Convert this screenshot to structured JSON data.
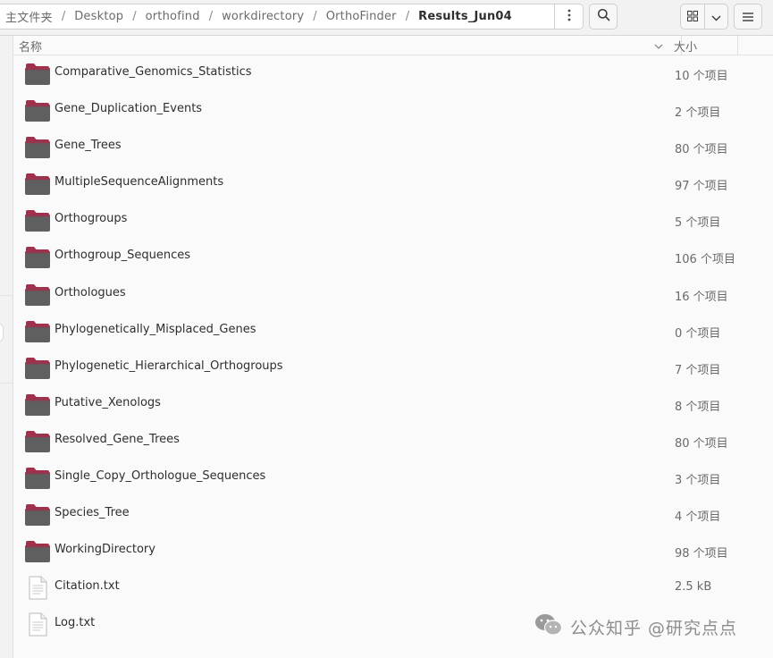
{
  "breadcrumb": [
    {
      "label": "主文件夹",
      "current": false
    },
    {
      "label": "Desktop",
      "current": false
    },
    {
      "label": "orthofind",
      "current": false
    },
    {
      "label": "workdirectory",
      "current": false
    },
    {
      "label": "OrthoFinder",
      "current": false
    },
    {
      "label": "Results_Jun04",
      "current": true
    }
  ],
  "breadcrumb_separator": "/",
  "columns": {
    "name": "名称",
    "size": "大小"
  },
  "files": [
    {
      "name": "Comparative_Genomics_Statistics",
      "size": "10 个项目",
      "type": "folder"
    },
    {
      "name": "Gene_Duplication_Events",
      "size": "2 个项目",
      "type": "folder"
    },
    {
      "name": "Gene_Trees",
      "size": "80 个项目",
      "type": "folder"
    },
    {
      "name": "MultipleSequenceAlignments",
      "size": "97 个项目",
      "type": "folder"
    },
    {
      "name": "Orthogroups",
      "size": "5 个项目",
      "type": "folder"
    },
    {
      "name": "Orthogroup_Sequences",
      "size": "106 个项目",
      "type": "folder"
    },
    {
      "name": "Orthologues",
      "size": "16 个项目",
      "type": "folder"
    },
    {
      "name": "Phylogenetically_Misplaced_Genes",
      "size": "0 个项目",
      "type": "folder"
    },
    {
      "name": "Phylogenetic_Hierarchical_Orthogroups",
      "size": "7 个项目",
      "type": "folder"
    },
    {
      "name": "Putative_Xenologs",
      "size": "8 个项目",
      "type": "folder"
    },
    {
      "name": "Resolved_Gene_Trees",
      "size": "80 个项目",
      "type": "folder"
    },
    {
      "name": "Single_Copy_Orthologue_Sequences",
      "size": "3 个项目",
      "type": "folder"
    },
    {
      "name": "Species_Tree",
      "size": "4 个项目",
      "type": "folder"
    },
    {
      "name": "WorkingDirectory",
      "size": "98 个项目",
      "type": "folder"
    },
    {
      "name": "Citation.txt",
      "size": "2.5 kB",
      "type": "text-file"
    },
    {
      "name": "Log.txt",
      "size": "",
      "type": "text-file"
    }
  ],
  "watermark": {
    "text": "公众知乎 @研究点点"
  },
  "colors": {
    "folder_body": "#5f5f5f",
    "folder_tab": "#a0304c",
    "accent": "#e95420"
  },
  "icons": {
    "path_menu": "kebab-menu-icon",
    "search": "search-icon",
    "view": "grid-view-icon",
    "view_dropdown": "chevron-down-icon",
    "main_menu": "hamburger-menu-icon"
  }
}
